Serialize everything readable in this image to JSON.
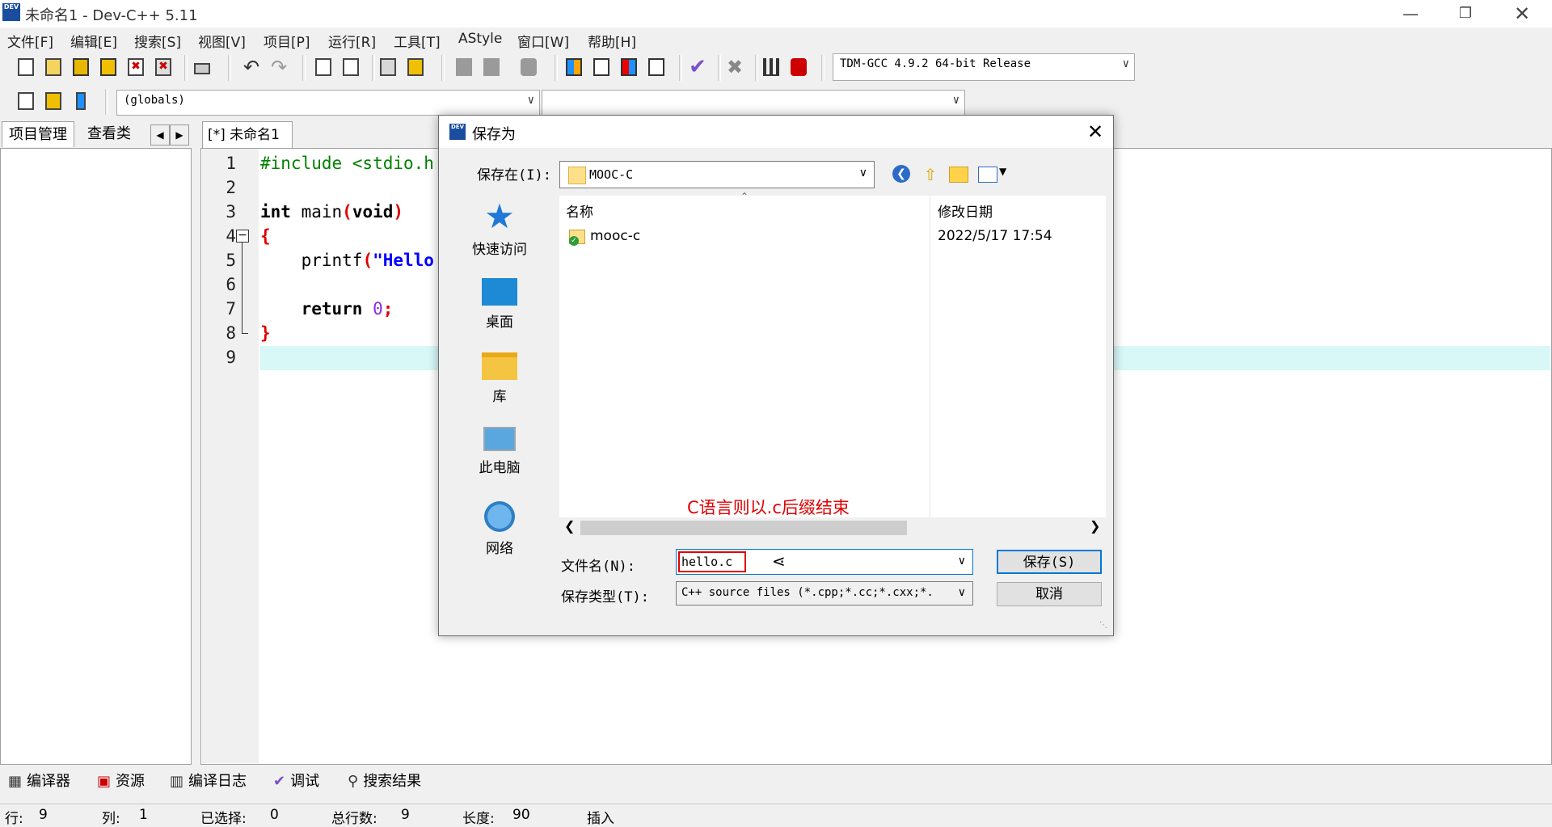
{
  "window": {
    "title": "未命名1 - Dev-C++ 5.11",
    "app_icon_text": "DEV"
  },
  "menu": [
    "文件[F]",
    "编辑[E]",
    "搜索[S]",
    "视图[V]",
    "项目[P]",
    "运行[R]",
    "工具[T]",
    "AStyle",
    "窗口[W]",
    "帮助[H]"
  ],
  "toolbar": {
    "compiler_select": "TDM-GCC 4.9.2 64-bit Release",
    "scope_select": "(globals)",
    "member_select": ""
  },
  "left_panel": {
    "tabs": [
      "项目管理",
      "查看类"
    ]
  },
  "editor": {
    "tab_label": "[*] 未命名1",
    "line_numbers": [
      "1",
      "2",
      "3",
      "4",
      "5",
      "6",
      "7",
      "8",
      "9"
    ]
  },
  "code": {
    "l1": "#include <stdio.h",
    "l3_kw": "int",
    "l3_rest": " main",
    "l3_paren_open": "(",
    "l3_void": "void",
    "l3_paren_close": ")",
    "l4": "{",
    "l5_fn": "    printf",
    "l5_paren": "(",
    "l5_str": "\"Hello",
    "l7_kw": "    return",
    "l7_num": " 0",
    "l7_semi": ";",
    "l8": "}"
  },
  "dialog": {
    "title": "保存为",
    "icon_text": "DEV",
    "save_in_label": "保存在(I):",
    "save_in_value": "MOOC-C",
    "places": [
      "快速访问",
      "桌面",
      "库",
      "此电脑",
      "网络"
    ],
    "columns": {
      "name": "名称",
      "modified": "修改日期"
    },
    "files": [
      {
        "name": "mooc-c",
        "modified": "2022/5/17 17:54"
      }
    ],
    "filename_label": "文件名(N):",
    "filename_value": "hello.c",
    "filetype_label": "保存类型(T):",
    "filetype_value": "C++ source files (*.cpp;*.cc;*.cxx;*.",
    "save_button": "保存(S)",
    "cancel_button": "取消",
    "annotation": "C语言则以.c后缀结束"
  },
  "bottom_tabs": [
    "编译器",
    "资源",
    "编译日志",
    "调试",
    "搜索结果"
  ],
  "status": {
    "row_label": "行:",
    "row_value": "9",
    "col_label": "列:",
    "col_value": "1",
    "sel_label": "已选择:",
    "sel_value": "0",
    "lines_label": "总行数:",
    "lines_value": "9",
    "len_label": "长度:",
    "len_value": "90",
    "mode": "插入"
  },
  "icons": [
    "new-file-icon",
    "open-icon",
    "save-icon",
    "save-all-icon",
    "close-icon",
    "close-all-icon",
    "print-icon",
    "undo-icon",
    "redo-icon",
    "find-icon",
    "replace-icon",
    "indent-icon",
    "unindent-icon",
    "back-icon",
    "forward-icon",
    "bookmark-icon",
    "compile-icon",
    "run-icon",
    "compile-run-icon",
    "rebuild-icon",
    "check-icon",
    "stop-icon",
    "chart-icon",
    "debug-icon"
  ]
}
